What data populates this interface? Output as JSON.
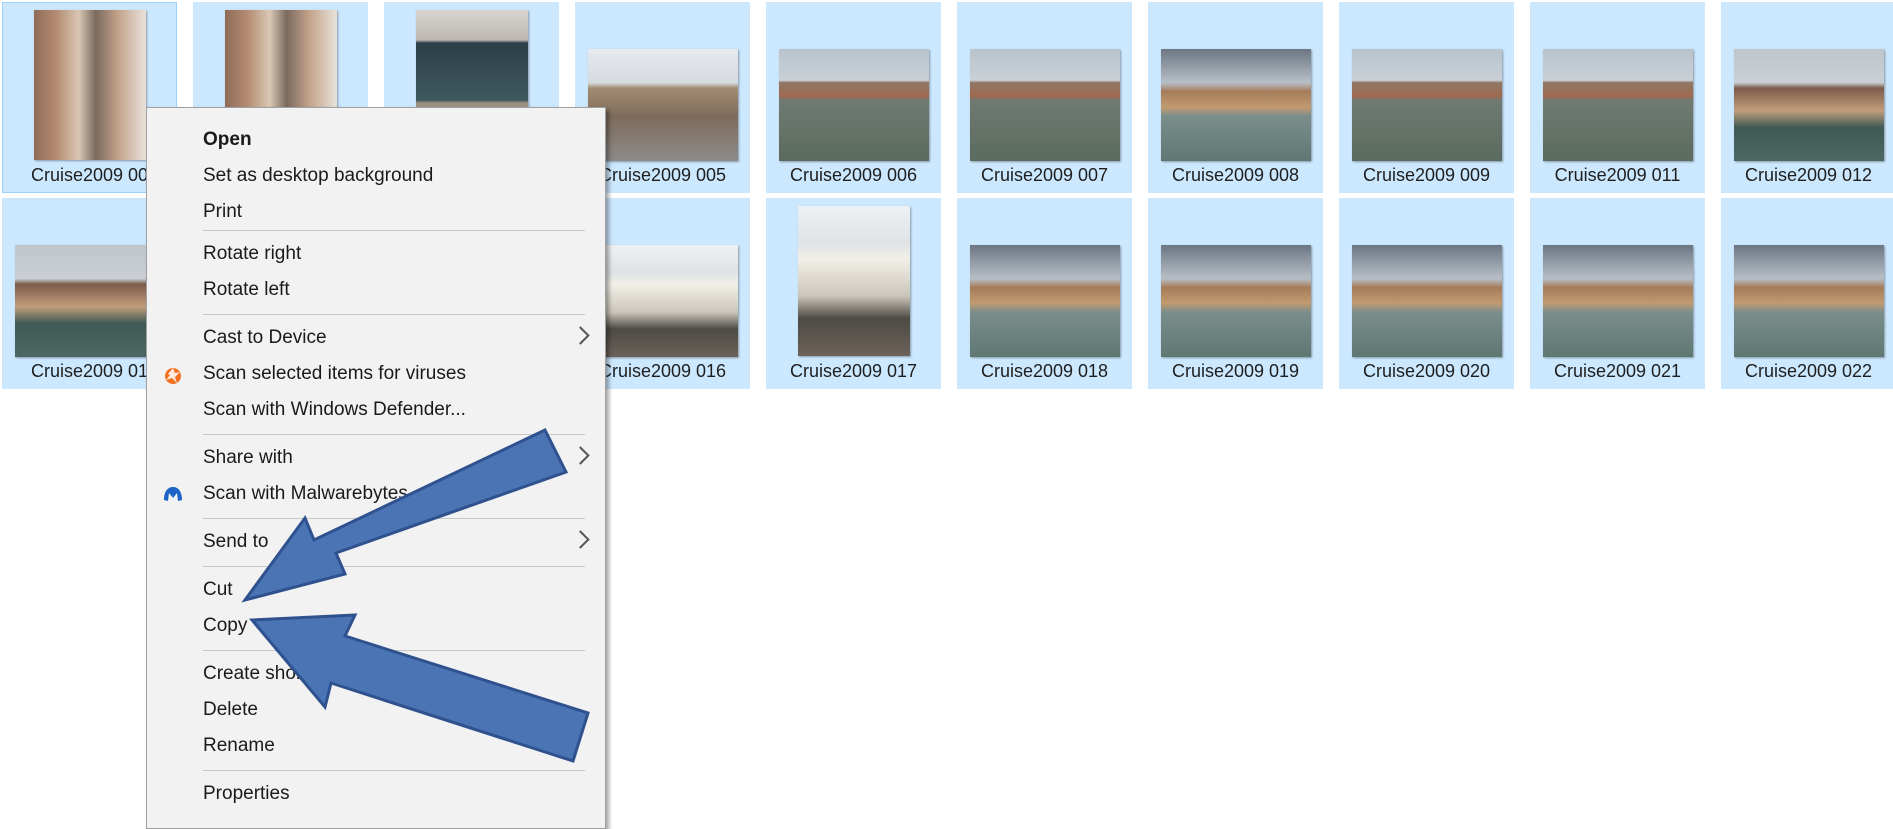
{
  "files_row1": [
    {
      "label": "Cruise2009 00",
      "orient": "port",
      "photo": "photo-bldg"
    },
    {
      "label": "",
      "orient": "port",
      "photo": "photo-bldg"
    },
    {
      "label": "",
      "orient": "port",
      "photo": "photo-door"
    },
    {
      "label": "Cruise2009 005",
      "orient": "land",
      "photo": "photo-sq"
    },
    {
      "label": "Cruise2009 006",
      "orient": "land",
      "photo": "photo-water"
    },
    {
      "label": "Cruise2009 007",
      "orient": "land",
      "photo": "photo-water"
    },
    {
      "label": "Cruise2009 008",
      "orient": "land",
      "photo": "photo-cloud"
    },
    {
      "label": "Cruise2009 009",
      "orient": "land",
      "photo": "photo-water"
    },
    {
      "label": "Cruise2009 011",
      "orient": "land",
      "photo": "photo-water"
    },
    {
      "label": "Cruise2009 012",
      "orient": "land",
      "photo": "photo-mix"
    }
  ],
  "files_row2": [
    {
      "label": "Cruise2009 01",
      "orient": "land",
      "photo": "photo-mix"
    },
    {
      "label": "",
      "orient": "land",
      "photo": "photo-water"
    },
    {
      "label": "",
      "orient": "land",
      "photo": "photo-water"
    },
    {
      "label": "Cruise2009 016",
      "orient": "land",
      "photo": "photo-bridge"
    },
    {
      "label": "Cruise2009 017",
      "orient": "port",
      "photo": "photo-bridge"
    },
    {
      "label": "Cruise2009 018",
      "orient": "land",
      "photo": "photo-cloud"
    },
    {
      "label": "Cruise2009 019",
      "orient": "land",
      "photo": "photo-cloud"
    },
    {
      "label": "Cruise2009 020",
      "orient": "land",
      "photo": "photo-cloud"
    },
    {
      "label": "Cruise2009 021",
      "orient": "land",
      "photo": "photo-cloud"
    },
    {
      "label": "Cruise2009 022",
      "orient": "land",
      "photo": "photo-cloud"
    }
  ],
  "context_menu": {
    "open": "Open",
    "set_desktop_bg": "Set as desktop background",
    "print": "Print",
    "rotate_right": "Rotate right",
    "rotate_left": "Rotate left",
    "cast_to_device": "Cast to Device",
    "scan_viruses": "Scan selected items for viruses",
    "scan_defender": "Scan with Windows Defender...",
    "share_with": "Share with",
    "scan_malwarebytes": "Scan with Malwarebytes",
    "send_to": "Send to",
    "cut": "Cut",
    "copy": "Copy",
    "create_shortcut": "Create shortcut",
    "delete": "Delete",
    "rename": "Rename",
    "properties": "Properties"
  },
  "icons": {
    "avast": "avast-icon",
    "malwarebytes": "malwarebytes-icon"
  },
  "colors": {
    "selection": "#cce8ff",
    "arrow_fill": "#4a74b3",
    "arrow_stroke": "#2f528f"
  }
}
